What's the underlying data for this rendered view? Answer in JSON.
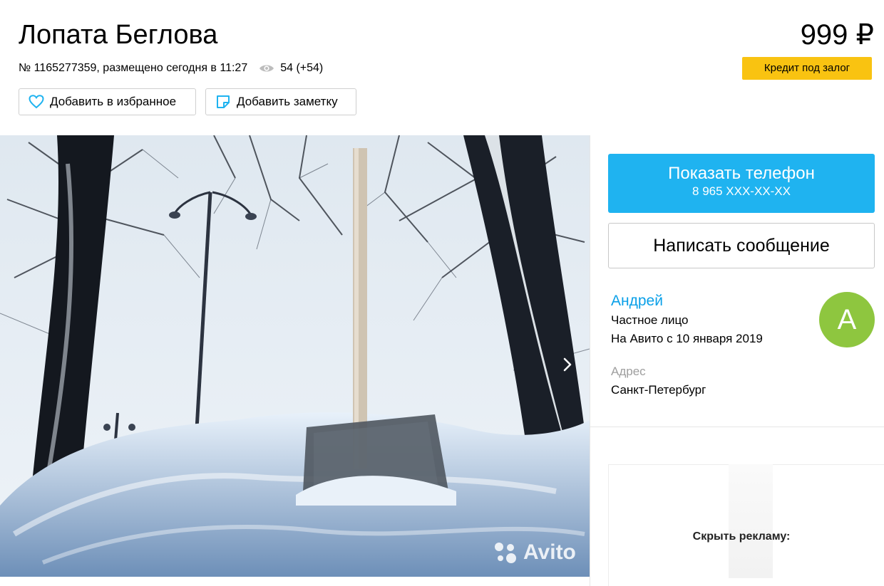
{
  "listing": {
    "title": "Лопата Беглова",
    "meta": "№ 1165277359, размещено сегодня в 11:27",
    "views": "54 (+54)",
    "price": "999 ₽",
    "credit_label": "Кредит под залог"
  },
  "actions": {
    "favorite_label": "Добавить в избранное",
    "note_label": "Добавить заметку"
  },
  "gallery": {
    "watermark": "Avito",
    "next_icon": "chevron-right-icon"
  },
  "contact": {
    "show_phone_label": "Показать телефон",
    "phone_masked": "8 965 XXX-XX-XX",
    "message_label": "Написать сообщение"
  },
  "seller": {
    "name": "Андрей",
    "type": "Частное лицо",
    "since": "На Авито с 10 января 2019",
    "avatar_letter": "А"
  },
  "address": {
    "label": "Адрес",
    "value": "Санкт-Петербург"
  },
  "ad": {
    "hide_label": "Скрыть рекламу:"
  },
  "colors": {
    "accent_blue": "#1fb3f0",
    "link_blue": "#0aa0e8",
    "credit_yellow": "#f9c311",
    "avatar_green": "#8ec63f"
  }
}
